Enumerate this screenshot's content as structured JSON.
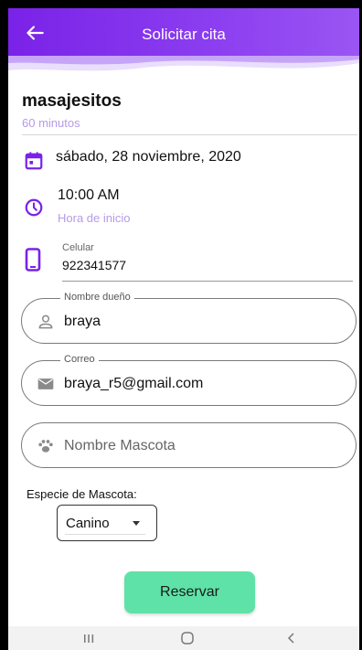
{
  "header": {
    "title": "Solicitar cita",
    "back_icon": "arrow-left-icon",
    "color": "#7a22e8"
  },
  "service": {
    "name": "masajesitos",
    "duration": "60 minutos"
  },
  "date": {
    "icon": "calendar-icon",
    "value": "sábado, 28 noviembre, 2020"
  },
  "time": {
    "icon": "clock-icon",
    "value": "10:00 AM",
    "hint": "Hora de inicio"
  },
  "phone": {
    "icon": "smartphone-icon",
    "label": "Celular",
    "value": "922341577"
  },
  "owner_field": {
    "label": "Nombre dueño",
    "value": "braya",
    "icon": "person-icon"
  },
  "email_field": {
    "label": "Correo",
    "value": "braya_r5@gmail.com",
    "icon": "mail-icon"
  },
  "pet_field": {
    "placeholder": "Nombre Mascota",
    "icon": "paw-icon"
  },
  "species": {
    "label": "Especie de Mascota:",
    "selected": "Canino"
  },
  "reserve_button": {
    "label": "Reservar",
    "color": "#5fe2a7"
  },
  "navigation_bar": {
    "recents_icon": "recents-icon",
    "home_icon": "home-icon",
    "back_icon": "back-chevron-icon"
  }
}
